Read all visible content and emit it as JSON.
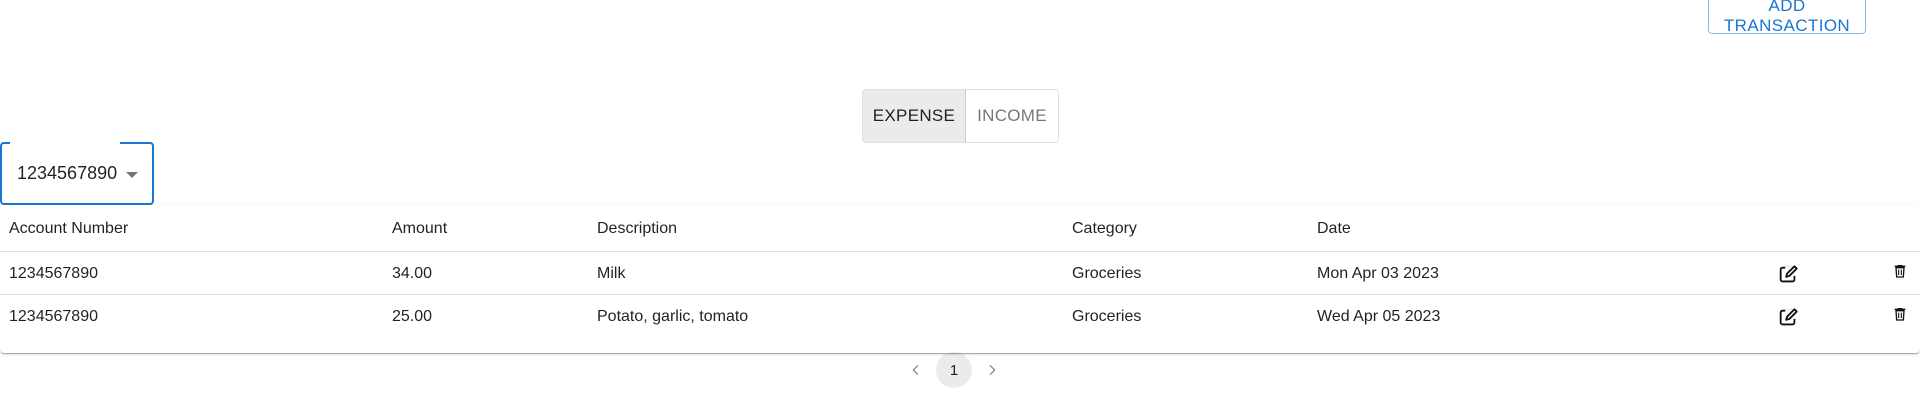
{
  "toolbar": {
    "add_transaction_label": "ADD TRANSACTION"
  },
  "type_toggle": {
    "options": [
      {
        "label": "EXPENSE",
        "selected": true
      },
      {
        "label": "INCOME",
        "selected": false
      }
    ]
  },
  "account_select": {
    "value": "1234567890"
  },
  "table": {
    "columns": [
      "Account Number",
      "Amount",
      "Description",
      "Category",
      "Date"
    ],
    "rows": [
      {
        "account": "1234567890",
        "amount": "34.00",
        "description": "Milk",
        "category": "Groceries",
        "date": "Mon Apr 03 2023"
      },
      {
        "account": "1234567890",
        "amount": "25.00",
        "description": "Potato, garlic, tomato",
        "category": "Groceries",
        "date": "Wed Apr 05 2023"
      }
    ],
    "row_actions": [
      "edit-icon",
      "delete-icon"
    ]
  },
  "pagination": {
    "current_page": "1",
    "prev_icon": "chevron-left-icon",
    "next_icon": "chevron-right-icon"
  },
  "colors": {
    "primary": "#1976d2",
    "selected_bg": "#ebebeb",
    "divider": "#e0e0e0"
  }
}
